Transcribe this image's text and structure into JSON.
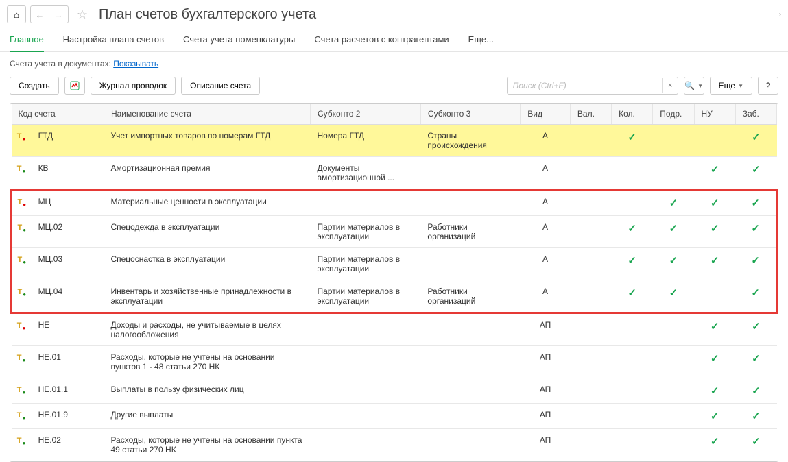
{
  "header": {
    "title": "План счетов бухгалтерского учета"
  },
  "tabs": [
    {
      "label": "Главное",
      "active": true
    },
    {
      "label": "Настройка плана счетов",
      "active": false
    },
    {
      "label": "Счета учета номенклатуры",
      "active": false
    },
    {
      "label": "Счета расчетов с контрагентами",
      "active": false
    },
    {
      "label": "Еще...",
      "active": false
    }
  ],
  "info_line": {
    "prefix": "Счета учета в документах: ",
    "link": "Показывать"
  },
  "toolbar": {
    "create": "Создать",
    "journal": "Журнал проводок",
    "description": "Описание счета",
    "more": "Еще",
    "help": "?"
  },
  "search": {
    "placeholder": "Поиск (Ctrl+F)"
  },
  "columns": {
    "code": "Код счета",
    "name": "Наименование счета",
    "sub2": "Субконто 2",
    "sub3": "Субконто 3",
    "vid": "Вид",
    "val": "Вал.",
    "kol": "Кол.",
    "podr": "Подр.",
    "nu": "НУ",
    "zab": "Заб."
  },
  "rows": [
    {
      "icon": "yr",
      "code": "ГТД",
      "name": "Учет импортных товаров по номерам ГТД",
      "sub2": "Номера ГТД",
      "sub3": "Страны происхождения",
      "vid": "А",
      "val": "",
      "kol": "✓",
      "podr": "",
      "nu": "",
      "zab": "✓",
      "hl": true
    },
    {
      "icon": "yg",
      "code": "КВ",
      "name": "Амортизационная премия",
      "sub2": "Документы амортизационной ...",
      "sub3": "",
      "vid": "А",
      "val": "",
      "kol": "",
      "podr": "",
      "nu": "✓",
      "zab": "✓"
    },
    {
      "icon": "yr",
      "code": "МЦ",
      "name": "Материальные ценности в эксплуатации",
      "sub2": "",
      "sub3": "",
      "vid": "А",
      "val": "",
      "kol": "",
      "podr": "✓",
      "nu": "✓",
      "zab": "✓",
      "frame": "top"
    },
    {
      "icon": "yg",
      "code": "МЦ.02",
      "name": "Спецодежда в эксплуатации",
      "sub2": "Партии материалов в эксплуатации",
      "sub3": "Работники организаций",
      "vid": "А",
      "val": "",
      "kol": "✓",
      "podr": "✓",
      "nu": "✓",
      "zab": "✓",
      "frame": "mid"
    },
    {
      "icon": "yg",
      "code": "МЦ.03",
      "name": "Спецоснастка в эксплуатации",
      "sub2": "Партии материалов в эксплуатации",
      "sub3": "",
      "vid": "А",
      "val": "",
      "kol": "✓",
      "podr": "✓",
      "nu": "✓",
      "zab": "✓",
      "frame": "mid"
    },
    {
      "icon": "yg",
      "code": "МЦ.04",
      "name": "Инвентарь и хозяйственные принадлежности в эксплуатации",
      "sub2": "Партии материалов в эксплуатации",
      "sub3": "Работники организаций",
      "vid": "А",
      "val": "",
      "kol": "✓",
      "podr": "✓",
      "nu": "",
      "zab": "✓",
      "frame": "bot"
    },
    {
      "icon": "yr",
      "code": "НЕ",
      "name": "Доходы и расходы, не учитываемые в целях налогообложения",
      "sub2": "",
      "sub3": "",
      "vid": "АП",
      "val": "",
      "kol": "",
      "podr": "",
      "nu": "✓",
      "zab": "✓"
    },
    {
      "icon": "yg",
      "code": "НЕ.01",
      "name": "Расходы, которые не учтены на основании пунктов 1 - 48 статьи 270 НК",
      "sub2": "",
      "sub3": "",
      "vid": "АП",
      "val": "",
      "kol": "",
      "podr": "",
      "nu": "✓",
      "zab": "✓"
    },
    {
      "icon": "yg",
      "code": "НЕ.01.1",
      "name": "Выплаты в пользу физических лиц",
      "sub2": "",
      "sub3": "",
      "vid": "АП",
      "val": "",
      "kol": "",
      "podr": "",
      "nu": "✓",
      "zab": "✓"
    },
    {
      "icon": "yg",
      "code": "НЕ.01.9",
      "name": "Другие выплаты",
      "sub2": "",
      "sub3": "",
      "vid": "АП",
      "val": "",
      "kol": "",
      "podr": "",
      "nu": "✓",
      "zab": "✓"
    },
    {
      "icon": "yg",
      "code": "НЕ.02",
      "name": "Расходы, которые не учтены на основании пункта 49 статьи 270 НК",
      "sub2": "",
      "sub3": "",
      "vid": "АП",
      "val": "",
      "kol": "",
      "podr": "",
      "nu": "✓",
      "zab": "✓"
    }
  ]
}
